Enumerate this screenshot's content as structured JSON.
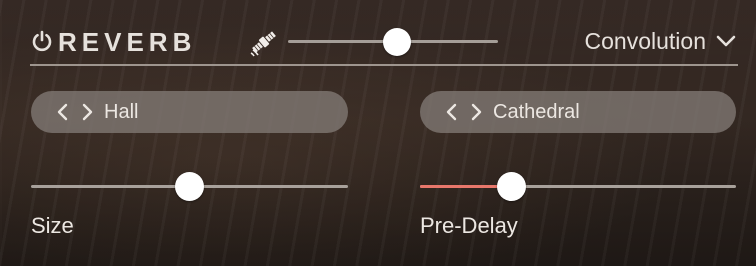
{
  "header": {
    "title": "REVERB",
    "power_icon": "power-icon",
    "mix_icon": "satellite-icon",
    "mix_slider_value": 0.52,
    "mode": "Convolution",
    "mode_dropdown_icon": "chevron-down-icon"
  },
  "presets": {
    "left": {
      "prev_icon": "chevron-left-icon",
      "next_icon": "chevron-right-icon",
      "label": "Hall"
    },
    "right": {
      "prev_icon": "chevron-left-icon",
      "next_icon": "chevron-right-icon",
      "label": "Cathedral"
    }
  },
  "params": {
    "size": {
      "label": "Size",
      "value": 0.5
    },
    "pre_delay": {
      "label": "Pre-Delay",
      "value": 0.29
    }
  },
  "colors": {
    "text": "#ece7e2",
    "track": "#a8a19b",
    "knob": "#ffffff",
    "accent_fill": "#e8776b"
  }
}
